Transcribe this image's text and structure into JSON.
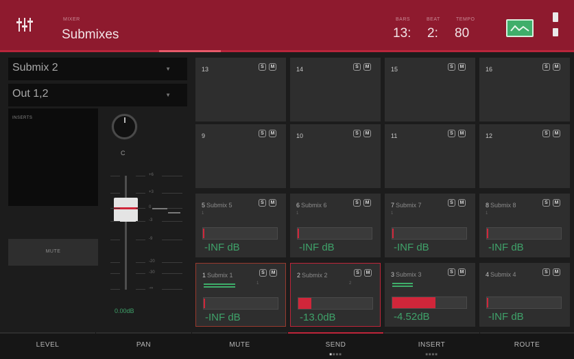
{
  "header": {
    "small_label": "MIXER",
    "title": "Submixes",
    "counter_labels": [
      "BARS",
      "BEAT",
      "TEMPO"
    ],
    "counter_values": [
      "13:",
      "2:",
      "80"
    ],
    "accent": "#8e1a2e"
  },
  "left": {
    "submix_select": "Submix 2",
    "output_select": "Out 1,2",
    "inserts_label": "INSERTS",
    "mute_label": "MUTE",
    "pan_value": "C",
    "fader_value": "0.00dB",
    "scale_labels": [
      "+6",
      "+3",
      "0",
      "-3",
      "-9",
      "-20",
      "-30",
      "-∞"
    ]
  },
  "pads": [
    {
      "num": "13",
      "name": "",
      "sub": "",
      "db": ""
    },
    {
      "num": "14",
      "name": "",
      "sub": "",
      "db": ""
    },
    {
      "num": "15",
      "name": "",
      "sub": "",
      "db": ""
    },
    {
      "num": "16",
      "name": "",
      "sub": "",
      "db": ""
    },
    {
      "num": "9",
      "name": "",
      "sub": "",
      "db": ""
    },
    {
      "num": "10",
      "name": "",
      "sub": "",
      "db": ""
    },
    {
      "num": "11",
      "name": "",
      "sub": "",
      "db": ""
    },
    {
      "num": "12",
      "name": "",
      "sub": "",
      "db": ""
    },
    {
      "num": "5",
      "name": "Submix 5",
      "sub": "1",
      "db": "-INF dB",
      "level": 0
    },
    {
      "num": "6",
      "name": "Submix 6",
      "sub": "1",
      "db": "-INF dB",
      "level": 0
    },
    {
      "num": "7",
      "name": "Submix 7",
      "sub": "1",
      "db": "-INF dB",
      "level": 0
    },
    {
      "num": "8",
      "name": "Submix 8",
      "sub": "1",
      "db": "-INF dB",
      "level": 0
    },
    {
      "num": "1",
      "name": "Submix 1",
      "sub": "1",
      "db": "-INF dB",
      "level": 0
    },
    {
      "num": "2",
      "name": "Submix 2",
      "sub": "2",
      "db": "-13.0dB",
      "level": 0.18
    },
    {
      "num": "3",
      "name": "Submix 3",
      "sub": "",
      "db": "-4.52dB",
      "level": 0.58
    },
    {
      "num": "4",
      "name": "Submix 4",
      "sub": "",
      "db": "-INF dB",
      "level": 0
    }
  ],
  "solo_label": "S",
  "mute_short": "M",
  "tabs": [
    {
      "label": "LEVEL"
    },
    {
      "label": "PAN"
    },
    {
      "label": "MUTE"
    },
    {
      "label": "SEND"
    },
    {
      "label": "INSERT"
    },
    {
      "label": "ROUTE"
    }
  ],
  "colors": {
    "meter_red": "#d0263a",
    "value_green": "#3fa26a"
  }
}
